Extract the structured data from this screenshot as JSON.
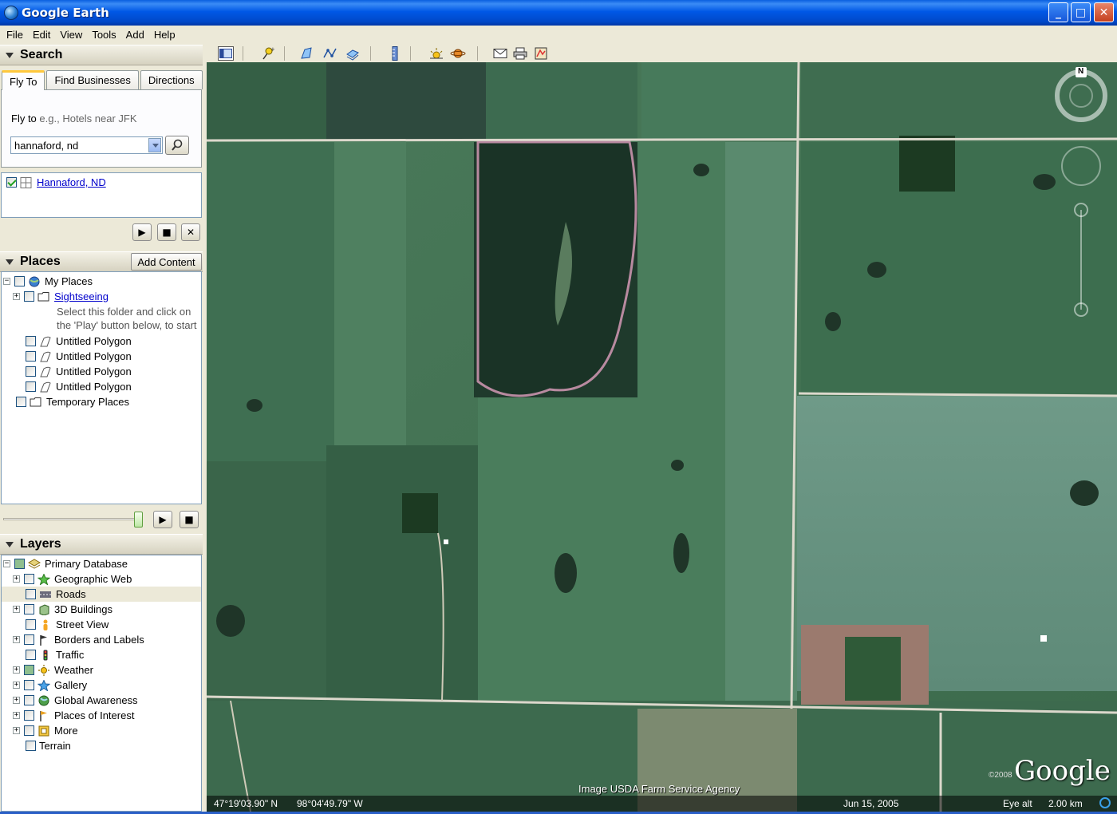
{
  "window": {
    "title": "Google Earth",
    "min": "_",
    "max": "□",
    "close": "✕"
  },
  "menu": [
    "File",
    "Edit",
    "View",
    "Tools",
    "Add",
    "Help"
  ],
  "search": {
    "header": "Search",
    "tabs": [
      "Fly To",
      "Find Businesses",
      "Directions"
    ],
    "flyto_label": "Fly to",
    "flyto_hint": "e.g., Hotels near JFK",
    "query": "hannaford, nd",
    "result": "Hannaford, ND"
  },
  "places": {
    "header": "Places",
    "add_content": "Add Content",
    "items": [
      {
        "label": "My Places"
      },
      {
        "label": "Sightseeing"
      },
      {
        "label": "Select this folder and click on"
      },
      {
        "label": "the 'Play' button below, to start"
      },
      {
        "label": "Untitled Polygon"
      },
      {
        "label": "Untitled Polygon"
      },
      {
        "label": "Untitled Polygon"
      },
      {
        "label": "Untitled Polygon"
      },
      {
        "label": "Temporary Places"
      }
    ]
  },
  "layers": {
    "header": "Layers",
    "items": [
      {
        "label": "Primary Database"
      },
      {
        "label": "Geographic Web"
      },
      {
        "label": "Roads"
      },
      {
        "label": "3D Buildings"
      },
      {
        "label": "Street View"
      },
      {
        "label": "Borders and Labels"
      },
      {
        "label": "Traffic"
      },
      {
        "label": "Weather"
      },
      {
        "label": "Gallery"
      },
      {
        "label": "Global Awareness"
      },
      {
        "label": "Places of Interest"
      },
      {
        "label": "More"
      },
      {
        "label": "Terrain"
      }
    ]
  },
  "map": {
    "attribution": "Image USDA Farm Service Agency",
    "logo": "Google",
    "logo_year": "©2008",
    "compass_n": "N",
    "status": {
      "lat": "47°19'03.90\" N",
      "lon": "98°04'49.79\" W",
      "date": "Jun 15, 2005",
      "eye_label": "Eye alt",
      "eye_value": "2.00 km"
    }
  },
  "controls": {
    "play": "▶",
    "stop": "■",
    "close": "✕"
  },
  "icons": [
    "globe-icon",
    "search-icon",
    "folder-icon",
    "polygon-icon",
    "layer-icon",
    "compass-icon"
  ]
}
